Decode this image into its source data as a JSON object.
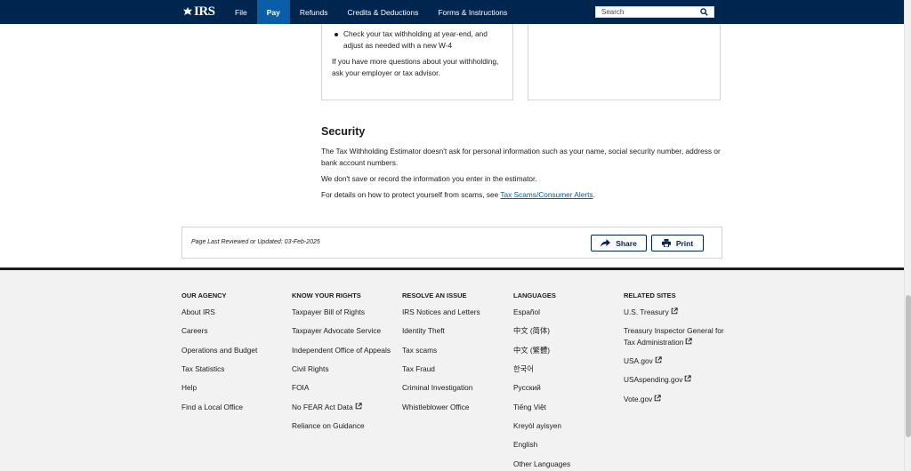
{
  "header": {
    "logo_text": "IRS",
    "nav": [
      "File",
      "Pay",
      "Refunds",
      "Credits & Deductions",
      "Forms & Instructions"
    ],
    "active_nav": "Pay",
    "search_placeholder": "Search"
  },
  "cards": {
    "bullet": "Check your tax withholding at year-end, and adjust as needed with a new W-4",
    "paragraph": "If you have more questions about your withholding, ask your employer or tax advisor."
  },
  "security": {
    "title": "Security",
    "p1": "The Tax Withholding Estimator doesn't ask for personal information such as your name, social security number, address or bank account numbers.",
    "p2": "We don't save or record the information you enter in the estimator.",
    "p3_prefix": "For details on how to protect yourself from scams, see ",
    "p3_link": "Tax Scams/Consumer Alerts",
    "p3_suffix": "."
  },
  "review": {
    "text": "Page Last Reviewed or Updated: 03-Feb-2025",
    "share_label": "Share",
    "print_label": "Print"
  },
  "footer": {
    "columns": [
      {
        "heading": "OUR AGENCY",
        "items": [
          "About IRS",
          "Careers",
          "Operations and Budget",
          "Tax Statistics",
          "Help",
          "Find a Local Office"
        ]
      },
      {
        "heading": "KNOW YOUR RIGHTS",
        "items": [
          "Taxpayer Bill of Rights",
          "Taxpayer Advocate Service",
          "Independent Office of Appeals",
          "Civil Rights",
          "FOIA",
          "No FEAR Act Data",
          "Reliance on Guidance"
        ]
      },
      {
        "heading": "RESOLVE AN ISSUE",
        "items": [
          "IRS Notices and Letters",
          "Identity Theft",
          "Tax scams",
          "Tax Fraud",
          "Criminal Investigation",
          "Whistleblower Office"
        ]
      },
      {
        "heading": "LANGUAGES",
        "items": [
          "Español",
          "中文 (简体)",
          "中文 (繁體)",
          "한국어",
          "Русский",
          "Tiếng Việt",
          "Kreyòl ayisyen",
          "English",
          "Other Languages"
        ]
      },
      {
        "heading": "RELATED SITES",
        "items": [
          "U.S. Treasury",
          "Treasury Inspector General for",
          "Tax Administration",
          "USA.gov",
          "USAspending.gov",
          "Vote.gov"
        ]
      }
    ]
  },
  "colors": {
    "header": "#00254f",
    "active_nav": "#0a5ea8",
    "link": "#00599c",
    "footer": "#f2f2f2"
  }
}
